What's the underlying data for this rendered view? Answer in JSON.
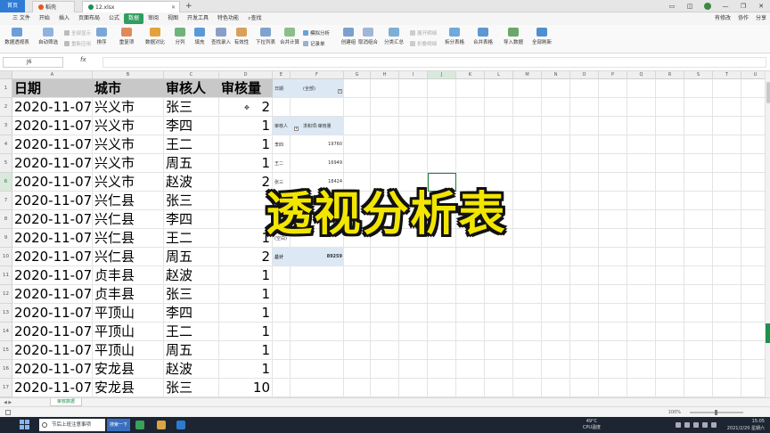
{
  "titlebar": {
    "home_tab": "首页",
    "tab2": "稻壳",
    "tab3": "12.xlsx",
    "new_tab": "+"
  },
  "menubar": {
    "file": "三 文件",
    "items": [
      "开始",
      "插入",
      "页面布局",
      "公式",
      "数据",
      "审阅",
      "视图",
      "开发工具",
      "特色功能"
    ],
    "active": "数据",
    "search": "查找",
    "right": [
      "有修改",
      "协作",
      "分享"
    ]
  },
  "ribbon": {
    "pivot": "数据透视表",
    "autofilter": "自动筛选",
    "show_all": "全部显示",
    "reapply": "重新应用",
    "sort": "排序",
    "dup": "重复项",
    "compare": "数据对比",
    "split": "分列",
    "fill": "填充",
    "find_entry": "查找录入",
    "validity": "有效性",
    "dropdown": "下拉列表",
    "consolidate": "合并计算",
    "simulate": "模拟分析",
    "record": "记录单",
    "group": "创建组",
    "ungroup": "取消组合",
    "subtotal": "分类汇总",
    "expand": "展开明细",
    "collapse": "折叠明细",
    "split_table": "拆分表格",
    "merge_table": "合并表格",
    "import": "导入数据",
    "refresh_all": "全部刷新"
  },
  "formulabar": {
    "namebox": "J6",
    "fx": "fx"
  },
  "columns": [
    "A",
    "B",
    "C",
    "D",
    "E",
    "F",
    "G",
    "H",
    "I",
    "J",
    "K",
    "L",
    "M",
    "N",
    "O",
    "P",
    "Q",
    "R",
    "S",
    "T",
    "U"
  ],
  "rows": [
    "1",
    "2",
    "3",
    "4",
    "5",
    "6",
    "7",
    "8",
    "9",
    "10",
    "11",
    "12",
    "13",
    "14",
    "15",
    "16",
    "17"
  ],
  "table": {
    "headers": [
      "日期",
      "城市",
      "审核人",
      "审核量"
    ],
    "data": [
      [
        "2020-11-07",
        "兴义市",
        "张三",
        "2"
      ],
      [
        "2020-11-07",
        "兴义市",
        "李四",
        "1"
      ],
      [
        "2020-11-07",
        "兴义市",
        "王二",
        "1"
      ],
      [
        "2020-11-07",
        "兴义市",
        "周五",
        "1"
      ],
      [
        "2020-11-07",
        "兴义市",
        "赵波",
        "2"
      ],
      [
        "2020-11-07",
        "兴仁县",
        "张三",
        ""
      ],
      [
        "2020-11-07",
        "兴仁县",
        "李四",
        ""
      ],
      [
        "2020-11-07",
        "兴仁县",
        "王二",
        "1"
      ],
      [
        "2020-11-07",
        "兴仁县",
        "周五",
        "2"
      ],
      [
        "2020-11-07",
        "贞丰县",
        "赵波",
        "1"
      ],
      [
        "2020-11-07",
        "贞丰县",
        "张三",
        "1"
      ],
      [
        "2020-11-07",
        "平顶山",
        "李四",
        "1"
      ],
      [
        "2020-11-07",
        "平顶山",
        "王二",
        "1"
      ],
      [
        "2020-11-07",
        "平顶山",
        "周五",
        "1"
      ],
      [
        "2020-11-07",
        "安龙县",
        "赵波",
        "1"
      ],
      [
        "2020-11-07",
        "安龙县",
        "张三",
        "10"
      ]
    ]
  },
  "pivot": {
    "filter_label": "日期",
    "filter_value": "(全部)",
    "row_label": "审核人",
    "value_label": "求和项:审核量",
    "rows": [
      {
        "name": "李四",
        "value": "19760"
      },
      {
        "name": "王二",
        "value": "16949"
      },
      {
        "name": "张三",
        "value": "18424"
      }
    ],
    "blank": "(空白)",
    "total_label": "总计",
    "total_value": "89259"
  },
  "banner": "透视分析表",
  "sheet": {
    "tab": "审核数据"
  },
  "statusbar": {
    "zoom": "100%"
  },
  "taskbar": {
    "search": "节后上班注意事项",
    "btn": "搜索一下",
    "weather_temp": "49°C",
    "weather_label": "CPU温度",
    "time": "15:05",
    "date": "2021/2/20 星期六"
  }
}
